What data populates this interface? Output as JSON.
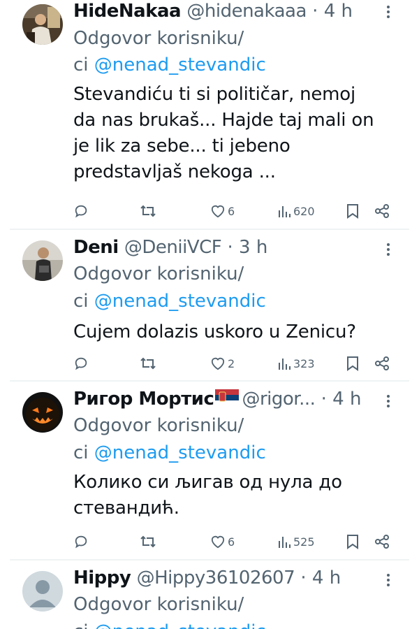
{
  "labels": {
    "reply_prefix_line1": "Odgovor korisniku/",
    "reply_prefix_line2": "ci",
    "separator": "·"
  },
  "tweets": [
    {
      "name": "HideNakaa",
      "handle": "@hidenakaaa",
      "time": "4 h",
      "reply_to": "@nenad_stevandic",
      "text_lines": [
        "Stevandiću ti si političar, nemoj",
        "da nas brukaš... Hajde taj mali on",
        "je lik za sebe... ti jebeno",
        "predstavljaš nekoga ..."
      ],
      "likes": "6",
      "views": "620"
    },
    {
      "name": "Deni",
      "handle": "@DeniiVCF",
      "time": "3 h",
      "reply_to": "@nenad_stevandic",
      "text_lines": [
        "Cujem dolazis uskoro u Zenicu?"
      ],
      "likes": "2",
      "views": "323"
    },
    {
      "name": "Ригор Мортис",
      "handle": "@rigor...",
      "time": "4 h",
      "reply_to": "@nenad_stevandic",
      "text_lines": [
        "Колико си љигав од нула до",
        "стевандић."
      ],
      "likes": "6",
      "views": "525"
    },
    {
      "name": "Hippy",
      "handle": "@Hippy36102607",
      "time": "4 h",
      "reply_to": "@nenad_stevandic",
      "text_lines": [],
      "likes": "",
      "views": ""
    }
  ],
  "icons": {
    "reply": "reply-icon",
    "retweet": "retweet-icon",
    "like": "heart-icon",
    "views": "views-icon",
    "bookmark": "bookmark-icon",
    "share": "share-icon",
    "more": "more-icon",
    "flag": "serbia-flag-icon"
  },
  "colors": {
    "text": "#0f1419",
    "secondary": "#536471",
    "link": "#1d9bf0",
    "separator": "#eff3f4"
  }
}
